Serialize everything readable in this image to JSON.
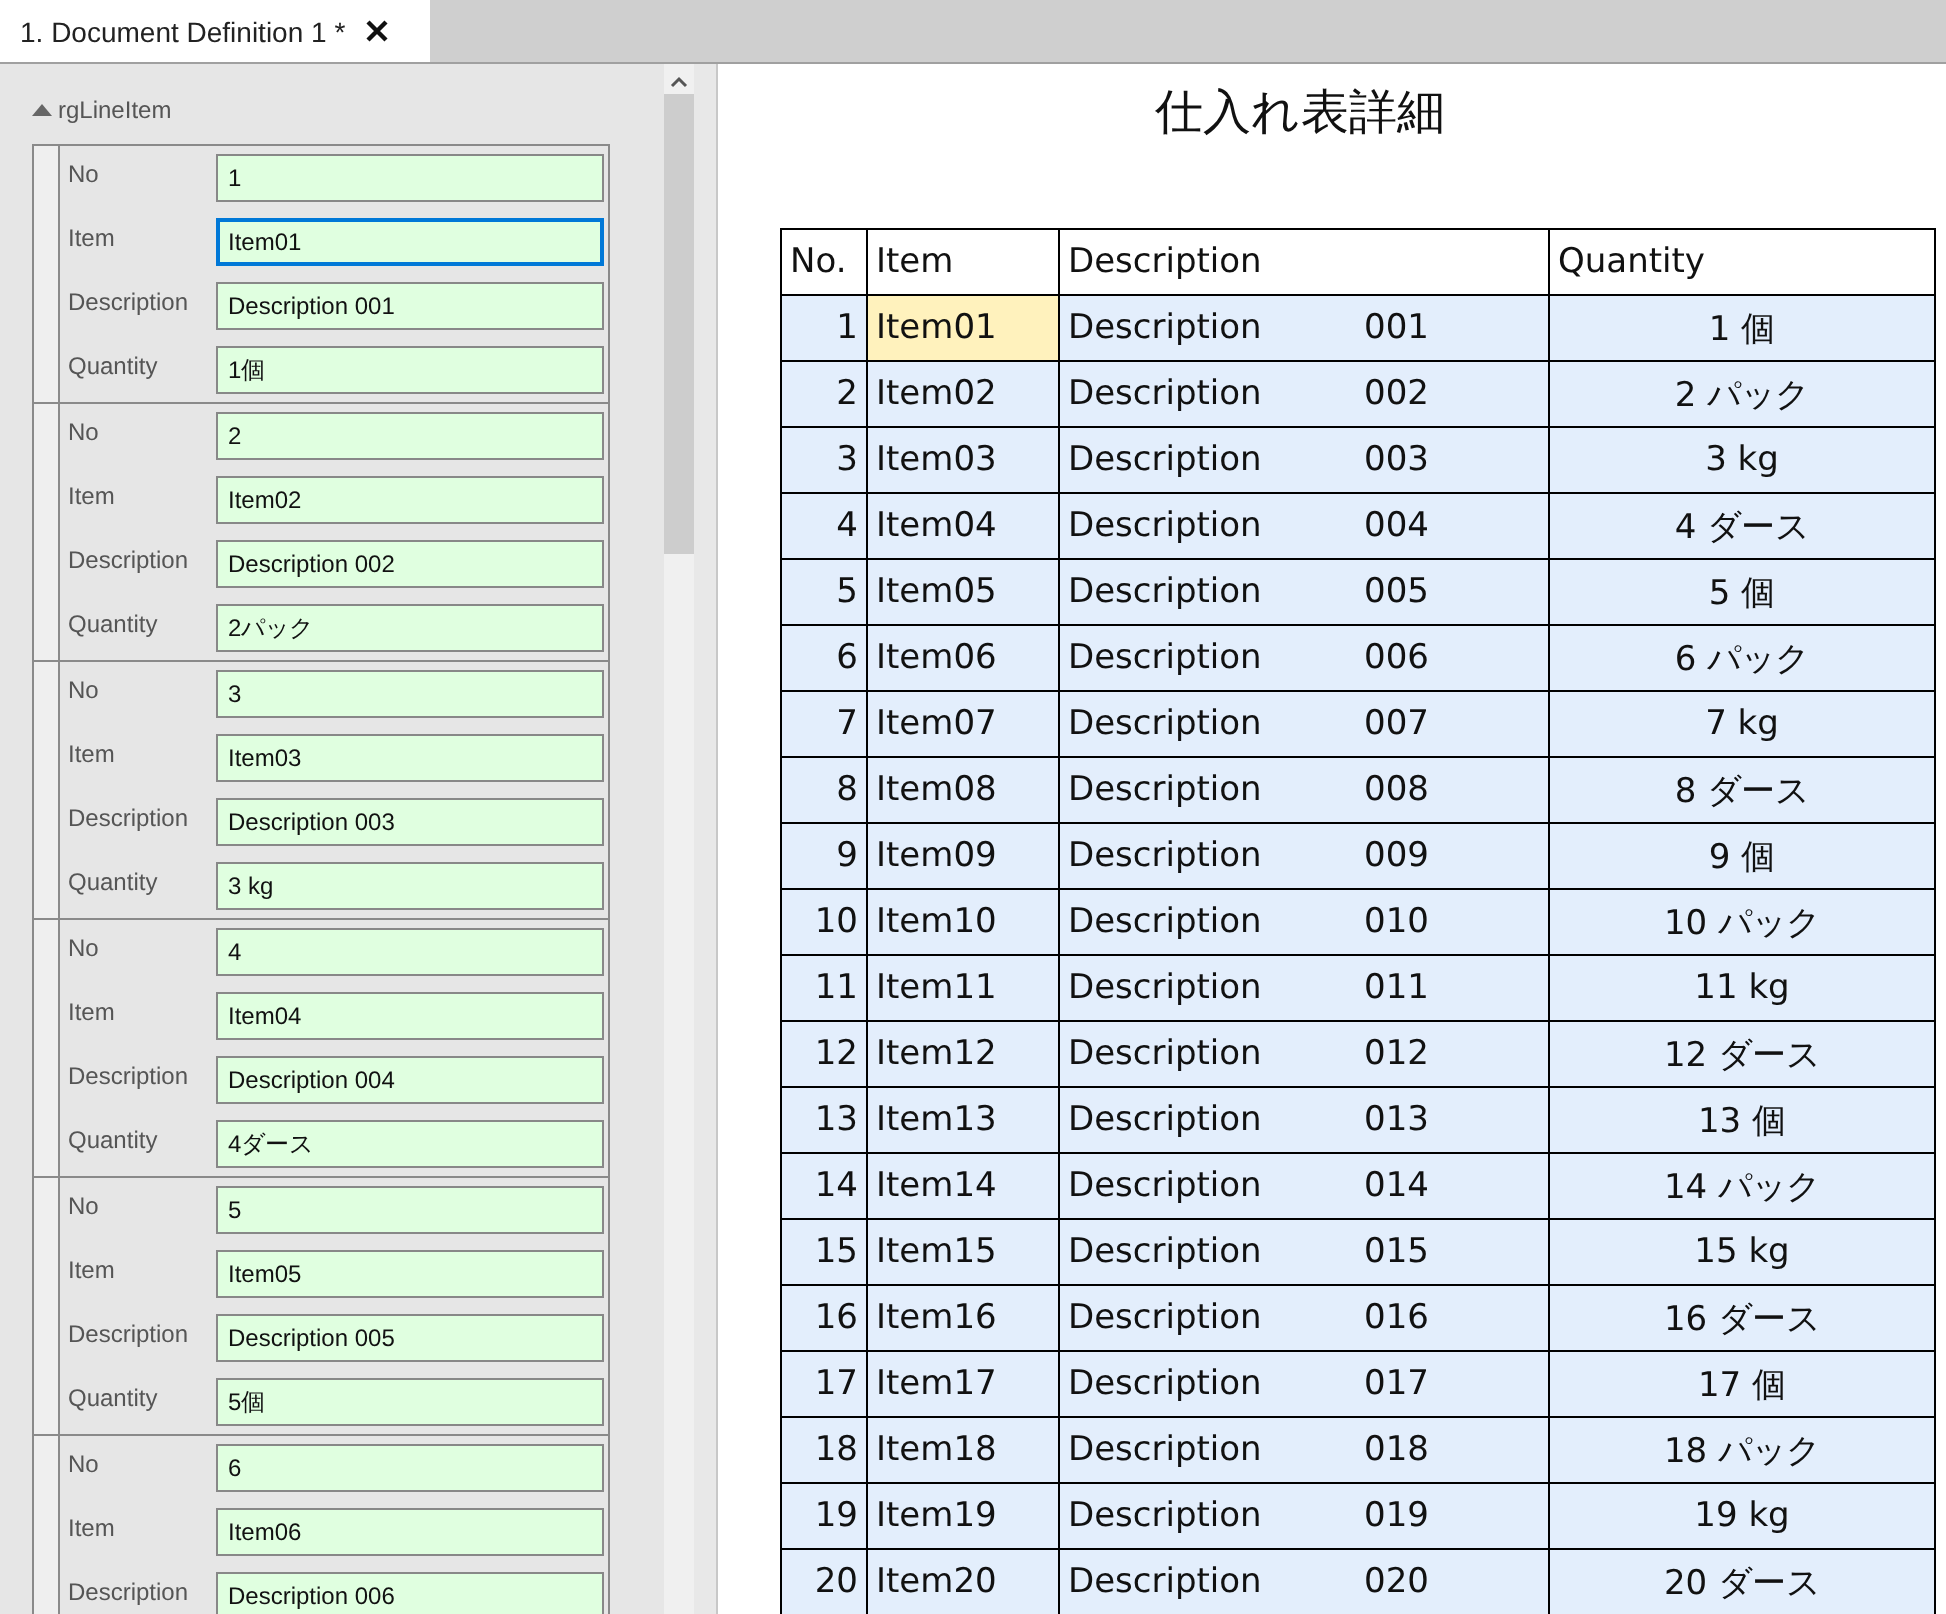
{
  "tab": {
    "label": "1. Document Definition 1 *",
    "selected": true
  },
  "group": {
    "label": "rgLineItem",
    "expanded": true
  },
  "records": [
    {
      "fields": [
        {
          "label": "No",
          "value": "1",
          "focused": false
        },
        {
          "label": "Item",
          "value": "Item01",
          "focused": true
        },
        {
          "label": "Description",
          "value": "Description 001",
          "focused": false
        },
        {
          "label": "Quantity",
          "value": "1個",
          "focused": false
        }
      ]
    },
    {
      "fields": [
        {
          "label": "No",
          "value": "2",
          "focused": false
        },
        {
          "label": "Item",
          "value": "Item02",
          "focused": false
        },
        {
          "label": "Description",
          "value": "Description 002",
          "focused": false
        },
        {
          "label": "Quantity",
          "value": "2パック",
          "focused": false
        }
      ]
    },
    {
      "fields": [
        {
          "label": "No",
          "value": "3",
          "focused": false
        },
        {
          "label": "Item",
          "value": "Item03",
          "focused": false
        },
        {
          "label": "Description",
          "value": "Description 003",
          "focused": false
        },
        {
          "label": "Quantity",
          "value": "3 kg",
          "focused": false
        }
      ]
    },
    {
      "fields": [
        {
          "label": "No",
          "value": "4",
          "focused": false
        },
        {
          "label": "Item",
          "value": "Item04",
          "focused": false
        },
        {
          "label": "Description",
          "value": "Description 004",
          "focused": false
        },
        {
          "label": "Quantity",
          "value": "4ダース",
          "focused": false
        }
      ]
    },
    {
      "fields": [
        {
          "label": "No",
          "value": "5",
          "focused": false
        },
        {
          "label": "Item",
          "value": "Item05",
          "focused": false
        },
        {
          "label": "Description",
          "value": "Description 005",
          "focused": false
        },
        {
          "label": "Quantity",
          "value": "5個",
          "focused": false
        }
      ]
    },
    {
      "fields": [
        {
          "label": "No",
          "value": "6",
          "focused": false
        },
        {
          "label": "Item",
          "value": "Item06",
          "focused": false
        },
        {
          "label": "Description",
          "value": "Description 006",
          "focused": false
        }
      ]
    }
  ],
  "report": {
    "title": "仕入れ表詳細",
    "columns": [
      "No.",
      "Item",
      "Description",
      "Quantity"
    ],
    "rows": [
      {
        "no": "1",
        "item": "Item01",
        "description": "Description",
        "code": "001",
        "quantity": "1 個",
        "selected": true
      },
      {
        "no": "2",
        "item": "Item02",
        "description": "Description",
        "code": "002",
        "quantity": "2 パック",
        "selected": false
      },
      {
        "no": "3",
        "item": "Item03",
        "description": "Description",
        "code": "003",
        "quantity": "3 kg",
        "selected": false
      },
      {
        "no": "4",
        "item": "Item04",
        "description": "Description",
        "code": "004",
        "quantity": "4 ダース",
        "selected": false
      },
      {
        "no": "5",
        "item": "Item05",
        "description": "Description",
        "code": "005",
        "quantity": "5 個",
        "selected": false
      },
      {
        "no": "6",
        "item": "Item06",
        "description": "Description",
        "code": "006",
        "quantity": "6 パック",
        "selected": false
      },
      {
        "no": "7",
        "item": "Item07",
        "description": "Description",
        "code": "007",
        "quantity": "7 kg",
        "selected": false
      },
      {
        "no": "8",
        "item": "Item08",
        "description": "Description",
        "code": "008",
        "quantity": "8 ダース",
        "selected": false
      },
      {
        "no": "9",
        "item": "Item09",
        "description": "Description",
        "code": "009",
        "quantity": "9 個",
        "selected": false
      },
      {
        "no": "10",
        "item": "Item10",
        "description": "Description",
        "code": "010",
        "quantity": "10 パック",
        "selected": false
      },
      {
        "no": "11",
        "item": "Item11",
        "description": "Description",
        "code": "011",
        "quantity": "11 kg",
        "selected": false
      },
      {
        "no": "12",
        "item": "Item12",
        "description": "Description",
        "code": "012",
        "quantity": "12 ダース",
        "selected": false
      },
      {
        "no": "13",
        "item": "Item13",
        "description": "Description",
        "code": "013",
        "quantity": "13 個",
        "selected": false
      },
      {
        "no": "14",
        "item": "Item14",
        "description": "Description",
        "code": "014",
        "quantity": "14 パック",
        "selected": false
      },
      {
        "no": "15",
        "item": "Item15",
        "description": "Description",
        "code": "015",
        "quantity": "15 kg",
        "selected": false
      },
      {
        "no": "16",
        "item": "Item16",
        "description": "Description",
        "code": "016",
        "quantity": "16 ダース",
        "selected": false
      },
      {
        "no": "17",
        "item": "Item17",
        "description": "Description",
        "code": "017",
        "quantity": "17 個",
        "selected": false
      },
      {
        "no": "18",
        "item": "Item18",
        "description": "Description",
        "code": "018",
        "quantity": "18 パック",
        "selected": false
      },
      {
        "no": "19",
        "item": "Item19",
        "description": "Description",
        "code": "019",
        "quantity": "19 kg",
        "selected": false
      },
      {
        "no": "20",
        "item": "Item20",
        "description": "Description",
        "code": "020",
        "quantity": "20 ダース",
        "selected": false
      }
    ]
  }
}
